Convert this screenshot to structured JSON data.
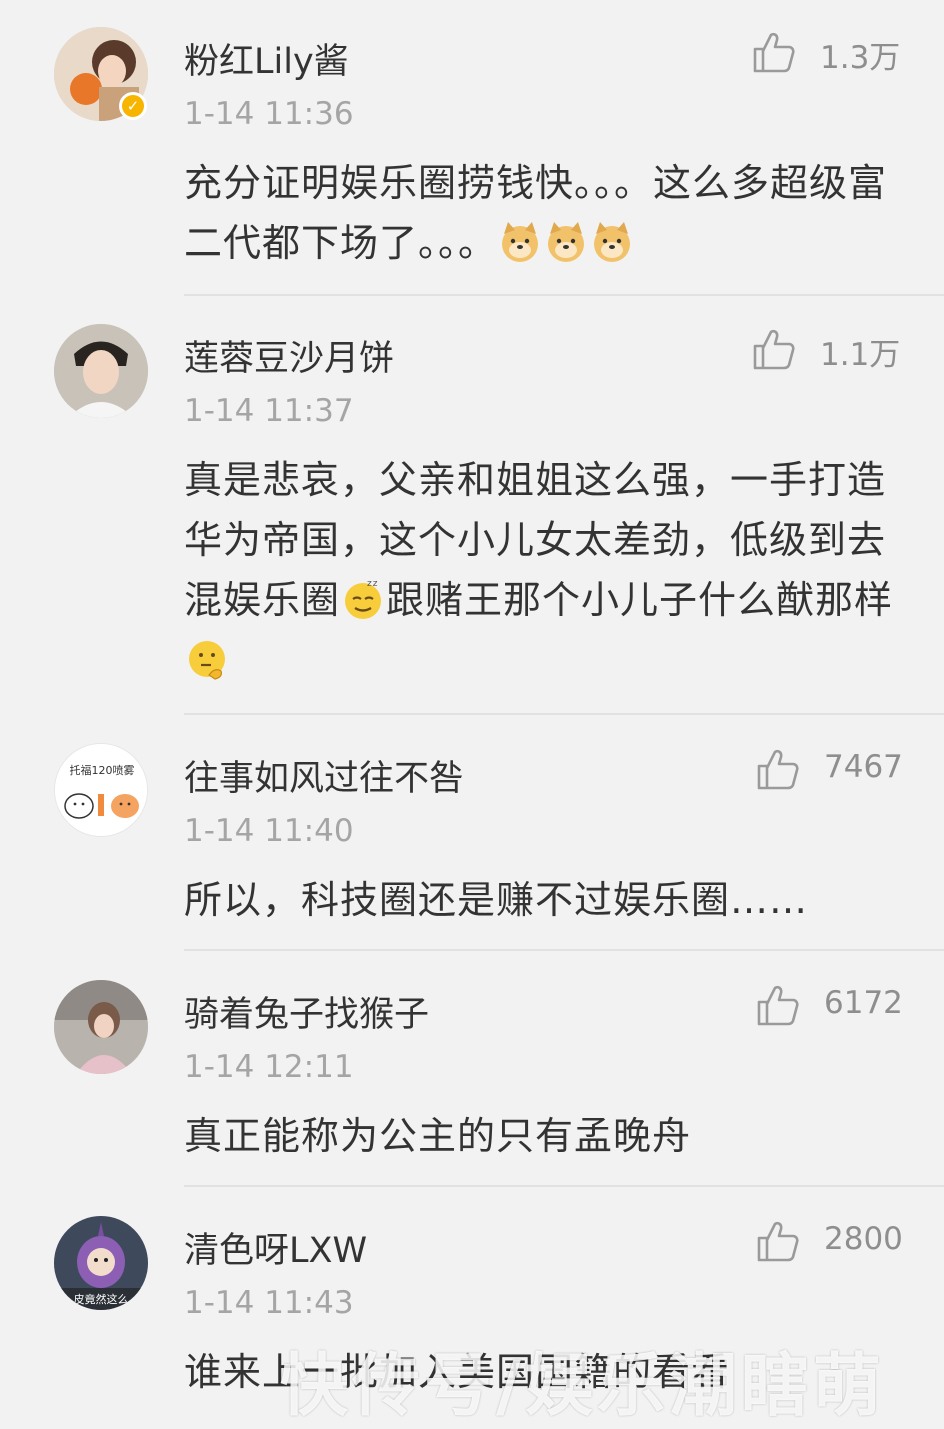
{
  "comments": [
    {
      "username": "粉红Lily酱",
      "time": "1-14 11:36",
      "likes": "1.3万",
      "text": "充分证明娱乐圈捞钱快。。。这么多超级富二代都下场了。。。",
      "verified": true
    },
    {
      "username": "莲蓉豆沙月饼",
      "time": "1-14 11:37",
      "likes": "1.1万",
      "text_a": "真是悲哀，父亲和姐姐这么强，一手打造华为帝国，这个小儿女太差劲，低级到去混娱乐圈",
      "text_b": "跟赌王那个小儿子什么猷那样"
    },
    {
      "username": "往事如风过往不咎",
      "time": "1-14 11:40",
      "likes": "7467",
      "text": "所以，科技圈还是赚不过娱乐圈……",
      "avatar_text": "托福120喷雾"
    },
    {
      "username": "骑着兔子找猴子",
      "time": "1-14 12:11",
      "likes": "6172",
      "text": "真正能称为公主的只有孟晚舟"
    },
    {
      "username": "清色呀LXW",
      "time": "1-14 11:43",
      "likes": "2800",
      "text": "谁来上一批加入美国国籍的看看",
      "avatar_text": "皮竟然这么"
    }
  ],
  "watermark": "快传号/娱乐潮瞎萌"
}
